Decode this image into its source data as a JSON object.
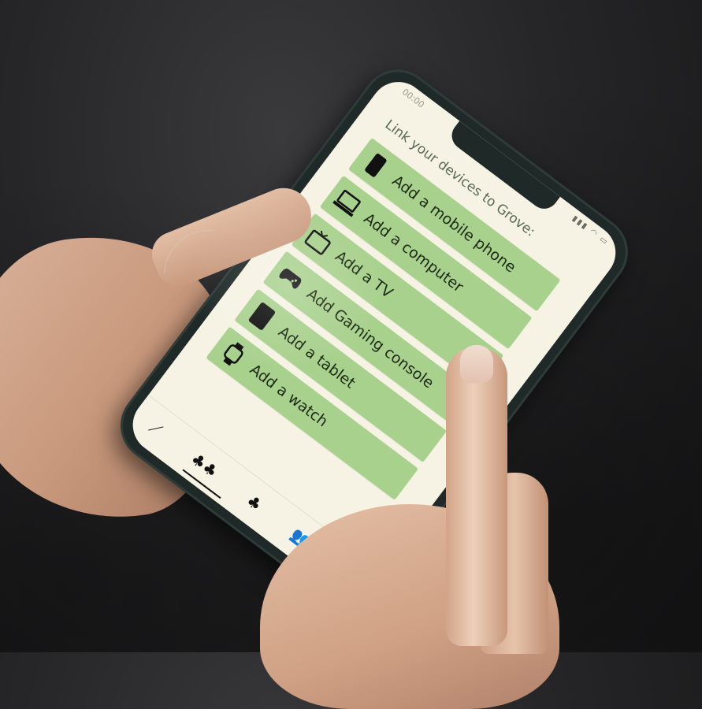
{
  "status_bar": {
    "time": "00:00",
    "icons": "▮▮▮ ◠ ▭"
  },
  "screen": {
    "prompt": "Link your devices to Grove:",
    "buttons": [
      {
        "label": "Add a mobile phone",
        "icon": "mobile-phone-icon"
      },
      {
        "label": "Add a computer",
        "icon": "laptop-icon"
      },
      {
        "label": "Add a TV",
        "icon": "tv-icon"
      },
      {
        "label": "Add Gaming console",
        "icon": "gamepad-icon"
      },
      {
        "label": "Add a tablet",
        "icon": "tablet-icon"
      },
      {
        "label": "Add a watch",
        "icon": "watch-icon"
      }
    ]
  },
  "navbar": {
    "items": [
      {
        "label": "",
        "icon": "stats-icon"
      },
      {
        "label": "",
        "icon": "forest-icon"
      },
      {
        "label": "",
        "icon": "tree-icon"
      },
      {
        "label": "",
        "icon": "friends-icon"
      },
      {
        "label": "",
        "icon": "profile-icon"
      }
    ]
  },
  "colors": {
    "button_green": "#a9d18e",
    "screen_bg": "#f6f3e4",
    "phone_case": "#1f2a28"
  }
}
